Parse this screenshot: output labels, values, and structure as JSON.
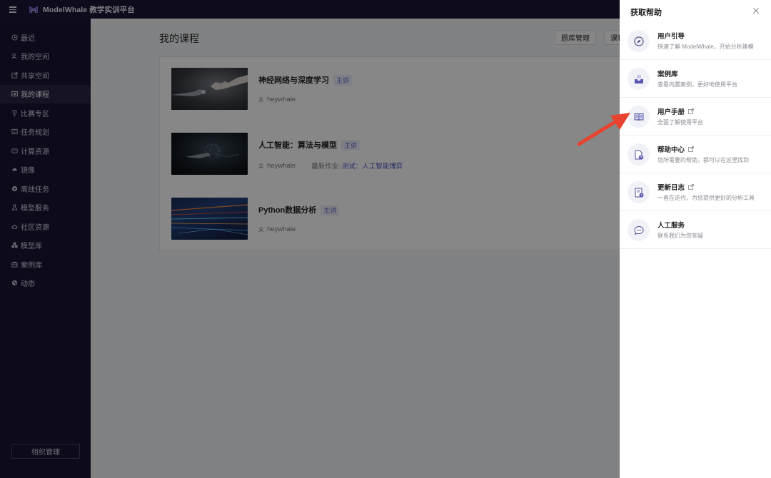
{
  "topbar": {
    "brand": "ModelWhale 教学实训平台"
  },
  "sidebar": {
    "items": [
      {
        "label": "最近",
        "icon": "clock-icon"
      },
      {
        "label": "我的空间",
        "icon": "user-icon"
      },
      {
        "label": "共享空间",
        "icon": "share-icon"
      },
      {
        "label": "我的课程",
        "icon": "course-icon",
        "active": true
      },
      {
        "label": "比赛专区",
        "icon": "trophy-icon"
      },
      {
        "label": "任务规划",
        "icon": "task-icon"
      },
      {
        "label": "计算资源",
        "icon": "compute-icon"
      },
      {
        "label": "镜像",
        "icon": "image-icon"
      },
      {
        "label": "离线任务",
        "icon": "offline-icon"
      },
      {
        "label": "模型服务",
        "icon": "flask-icon"
      },
      {
        "label": "社区资源",
        "icon": "cloud-icon"
      },
      {
        "label": "模型库",
        "icon": "cubes-icon"
      },
      {
        "label": "案例库",
        "icon": "case-icon"
      },
      {
        "label": "动态",
        "icon": "activity-icon"
      }
    ],
    "org_button": "组织管理"
  },
  "main": {
    "title": "我的课程",
    "toolbar": {
      "bank_label": "题库管理",
      "course_label": "课程"
    },
    "courses": [
      {
        "title": "神经网络与深度学习",
        "badge": "主讲",
        "author": "heywhale",
        "homework_label": "",
        "homework_link": ""
      },
      {
        "title": "人工智能：算法与模型",
        "badge": "主讲",
        "author": "heywhale",
        "homework_label": "最新作业:",
        "homework_link": "测试：人工智能博弈"
      },
      {
        "title": "Python数据分析",
        "badge": "主讲",
        "author": "heywhale",
        "homework_label": "",
        "homework_link": ""
      }
    ]
  },
  "help_panel": {
    "title": "获取帮助",
    "close_icon": "close-icon",
    "items": [
      {
        "title": "用户引导",
        "desc": "快速了解 ModelWhale，开始分析建模",
        "icon": "compass-icon",
        "external": false
      },
      {
        "title": "案例库",
        "desc": "查看内置案例，更好地使用平台",
        "icon": "inbox-icon",
        "external": false
      },
      {
        "title": "用户手册",
        "desc": "全面了解使用平台",
        "icon": "book-icon",
        "external": true
      },
      {
        "title": "帮助中心",
        "desc": "您所需要的帮助，都可以在这里找到",
        "icon": "help-file-icon",
        "external": true
      },
      {
        "title": "更新日志",
        "desc": "一直在迭代，为您提供更好的分析工具",
        "icon": "log-icon",
        "external": true
      },
      {
        "title": "人工服务",
        "desc": "联系我们为您答疑",
        "icon": "chat-icon",
        "external": false
      }
    ]
  },
  "colors": {
    "sidebar_bg": "#1a1533",
    "accent": "#5b63c9",
    "arrow": "#e8432f"
  }
}
